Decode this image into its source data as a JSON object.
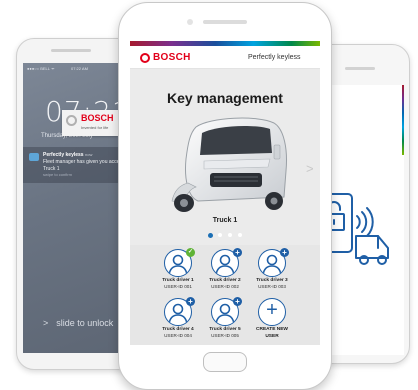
{
  "left_phone": {
    "status_carrier": "●●●○○ BELL ᯤ",
    "status_time": "07:22 AM",
    "lock_time": "07:21",
    "lock_date": "Thursday, 26th July",
    "notification": {
      "app": "Perfectly keyless",
      "time": "now",
      "message": "Fleet manager has given you access to Truck 1",
      "action": "swipe to confirm"
    },
    "unlock_chevron": ">",
    "unlock_text": "slide to unlock"
  },
  "right_phone": {
    "logo_word": "BOSCH",
    "logo_tagline": "Invented for life"
  },
  "center_phone": {
    "brand": "BOSCH",
    "header_right": "Perfectly keyless",
    "title": "Key management",
    "truck_label": "Truck 1",
    "carousel_arrow": ">",
    "carousel": {
      "pages": 4,
      "active": 0
    },
    "users": [
      {
        "name": "Truck driver 1",
        "id": "USER-ID 001",
        "badge": "check",
        "badge_glyph": "✓"
      },
      {
        "name": "Truck driver 2",
        "id": "USER-ID 002",
        "badge": "plus",
        "badge_glyph": "+"
      },
      {
        "name": "Truck driver 3",
        "id": "USER-ID 003",
        "badge": "plus",
        "badge_glyph": "+"
      },
      {
        "name": "Truck driver 4",
        "id": "USER-ID 004",
        "badge": "plus",
        "badge_glyph": "+"
      },
      {
        "name": "Truck driver 5",
        "id": "USER-ID 005",
        "badge": "plus",
        "badge_glyph": "+"
      }
    ],
    "create_user": {
      "line1": "CREATE NEW",
      "line2": "USER",
      "glyph": "+"
    }
  },
  "colors": {
    "bosch_red": "#e2001a",
    "accent_blue": "#1f5fa6",
    "check_green": "#5fb336",
    "lock_bg": "#6a7483"
  }
}
